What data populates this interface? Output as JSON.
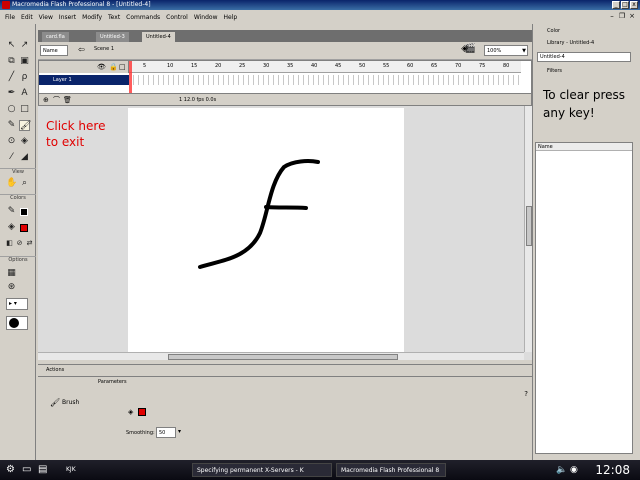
{
  "window": {
    "title": "Macromedia Flash Professional 8 - [Untitled-4]"
  },
  "menu": [
    "File",
    "Edit",
    "View",
    "Insert",
    "Modify",
    "Text",
    "Commands",
    "Control",
    "Window",
    "Help"
  ],
  "tools": {
    "section_view": "View",
    "section_colors": "Colors",
    "section_options": "Options"
  },
  "document": {
    "tabs": [
      "card.fla",
      "Untitled-3",
      "Untitled-4"
    ],
    "scene_field": "Name",
    "scene_label": "Scene 1",
    "zoom": "100%"
  },
  "timeline": {
    "layer_name": "Layer 1",
    "ruler": [
      "5",
      "10",
      "15",
      "20",
      "25",
      "30",
      "35",
      "40",
      "45",
      "50",
      "55",
      "60",
      "65",
      "70",
      "75",
      "80"
    ],
    "status": "1   12.0 fps   0.0s"
  },
  "stage": {
    "exit_text": "Click here to exit",
    "exit_color": "#e00000"
  },
  "panels": {
    "actions": "Actions",
    "properties": "Parameters",
    "props_tool": "Brush",
    "smoothing_label": "Smoothing:",
    "smoothing_value": "50",
    "stroke_color": "#e00000"
  },
  "right": {
    "color_header": "Color",
    "library_header": "Library - Untitled-4",
    "library_select": "Untitled-4",
    "filters_header": "Filters",
    "clear_text": "To clear press any key!",
    "list_header": "Name"
  },
  "taskbar": {
    "item1": "KJK",
    "item2": "Specifying permanent X-Servers - K",
    "item3": "Macromedia Flash Professional 8",
    "clock": "12:08"
  }
}
